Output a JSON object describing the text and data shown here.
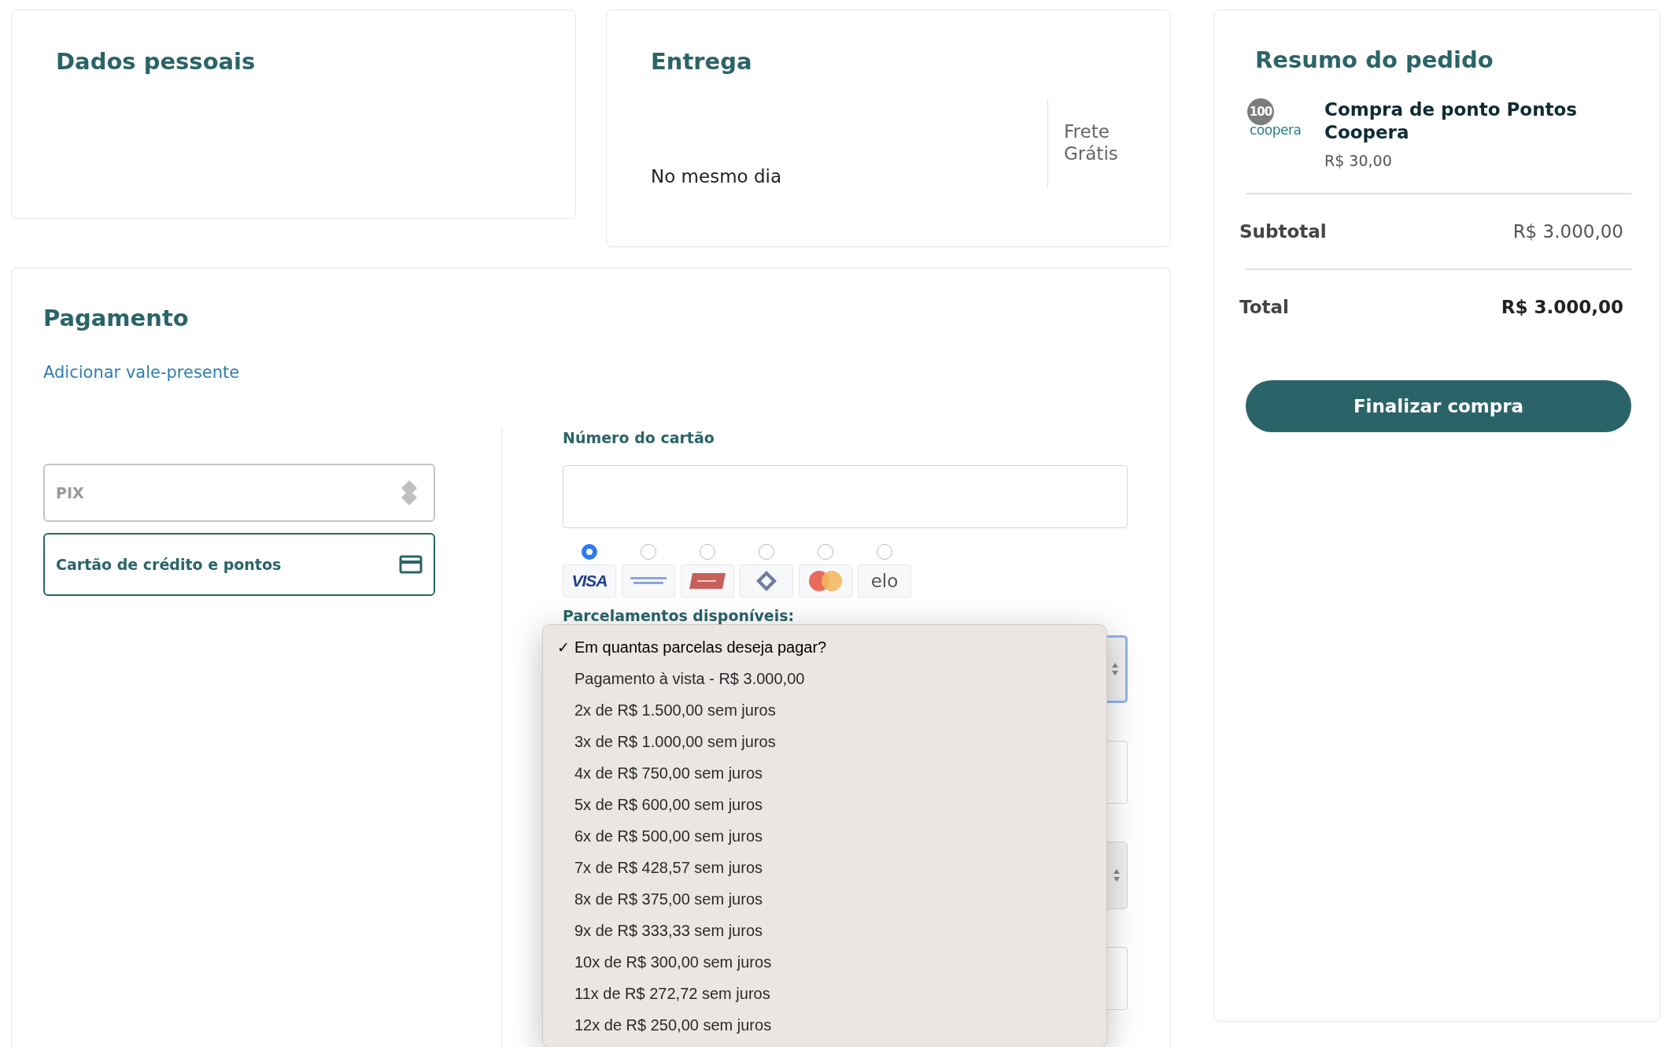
{
  "personal": {
    "title": "Dados pessoais"
  },
  "delivery": {
    "title": "Entrega",
    "option": "No mesmo dia",
    "price": "Frete Grátis"
  },
  "payment": {
    "title": "Pagamento",
    "gift_link": "Adicionar vale-presente",
    "methods": [
      {
        "kind": "pix",
        "label": "PIX",
        "selected": false
      },
      {
        "kind": "card",
        "label": "Cartão de crédito e pontos",
        "selected": true
      }
    ],
    "card_number": {
      "label": "Número do cartão"
    },
    "card_brands": [
      {
        "kind": "visa",
        "label": "VISA",
        "selected": true
      },
      {
        "kind": "amex",
        "selected": false
      },
      {
        "kind": "hipercard",
        "selected": false
      },
      {
        "kind": "diamond",
        "selected": false
      },
      {
        "kind": "mastercard",
        "selected": false
      },
      {
        "kind": "elo",
        "label": "elo",
        "selected": false
      }
    ],
    "installments": {
      "label": "Parcelamentos disponíveis:",
      "check_mark": "✓",
      "options": [
        {
          "label": "Em quantas parcelas deseja pagar?",
          "selected": true
        },
        {
          "label": "Pagamento à vista - R$ 3.000,00",
          "selected": false
        },
        {
          "label": "2x de R$ 1.500,00 sem juros",
          "selected": false
        },
        {
          "label": "3x de R$ 1.000,00 sem juros",
          "selected": false
        },
        {
          "label": "4x de R$ 750,00 sem juros",
          "selected": false
        },
        {
          "label": "5x de R$ 600,00 sem juros",
          "selected": false
        },
        {
          "label": "6x de R$ 500,00 sem juros",
          "selected": false
        },
        {
          "label": "7x de R$ 428,57 sem juros",
          "selected": false
        },
        {
          "label": "8x de R$ 375,00 sem juros",
          "selected": false
        },
        {
          "label": "9x de R$ 333,33 sem juros",
          "selected": false
        },
        {
          "label": "10x de R$ 300,00 sem juros",
          "selected": false
        },
        {
          "label": "11x de R$ 272,72 sem juros",
          "selected": false
        },
        {
          "label": "12x de R$ 250,00 sem juros",
          "selected": false
        }
      ]
    }
  },
  "summary": {
    "title": "Resumo do pedido",
    "product": {
      "logo_badge": "100",
      "logo_text": "coopera",
      "name": "Compra de ponto Pontos Coopera",
      "price": "R$ 30,00"
    },
    "subtotal": {
      "label": "Subtotal",
      "value": "R$ 3.000,00"
    },
    "total": {
      "label": "Total",
      "value": "R$ 3.000,00"
    },
    "button": "Finalizar compra"
  }
}
